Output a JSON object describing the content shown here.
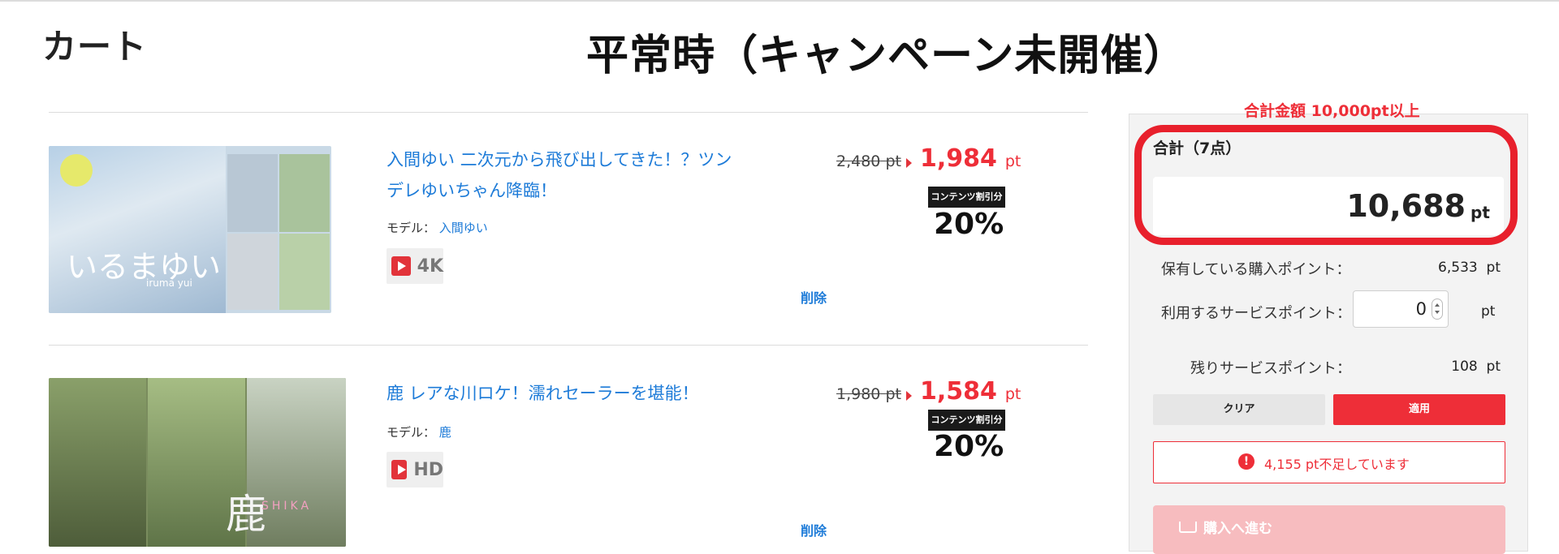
{
  "header": {
    "cart_title": "カート",
    "heading": "平常時（キャンペーン未開催）"
  },
  "items": [
    {
      "title": "入間ゆい 二次元から飛び出してきた！？ツンデレゆいちゃん降臨！",
      "model_label": "モデル：",
      "model_name": "入間ゆい",
      "resolution": "4K",
      "old_price": "2,480",
      "pt": "pt",
      "new_price": "1,984",
      "discount_label": "コンテンツ割引分",
      "discount_value": "20%",
      "delete_label": "削除",
      "thumb_text": "いるまゆい",
      "thumb_sub": "iruma yui"
    },
    {
      "title": "鹿 レアな川ロケ！濡れセーラーを堪能！",
      "model_label": "モデル：",
      "model_name": "鹿",
      "resolution": "HD",
      "old_price": "1,980",
      "pt": "pt",
      "new_price": "1,584",
      "discount_label": "コンテンツ割引分",
      "discount_value": "20%",
      "delete_label": "削除",
      "thumb_text": "鹿",
      "thumb_sub": "SHIKA"
    }
  ],
  "summary": {
    "notice": "合計金額 10,000pt以上",
    "total_label": "合計（7点）",
    "total_amount": "10,688",
    "unit": "pt",
    "owned_label": "保有している購入ポイント：",
    "owned_value": "6,533",
    "use_label": "利用するサービスポイント：",
    "use_value": "0",
    "remaining_label": "残りサービスポイント：",
    "remaining_value": "108",
    "clear_label": "クリア",
    "apply_label": "適用",
    "alert_text": "4,155 pt不足しています",
    "buy_label": "購入へ進む"
  },
  "colors": {
    "accent": "#ee2e38",
    "link": "#1d7bd8"
  }
}
